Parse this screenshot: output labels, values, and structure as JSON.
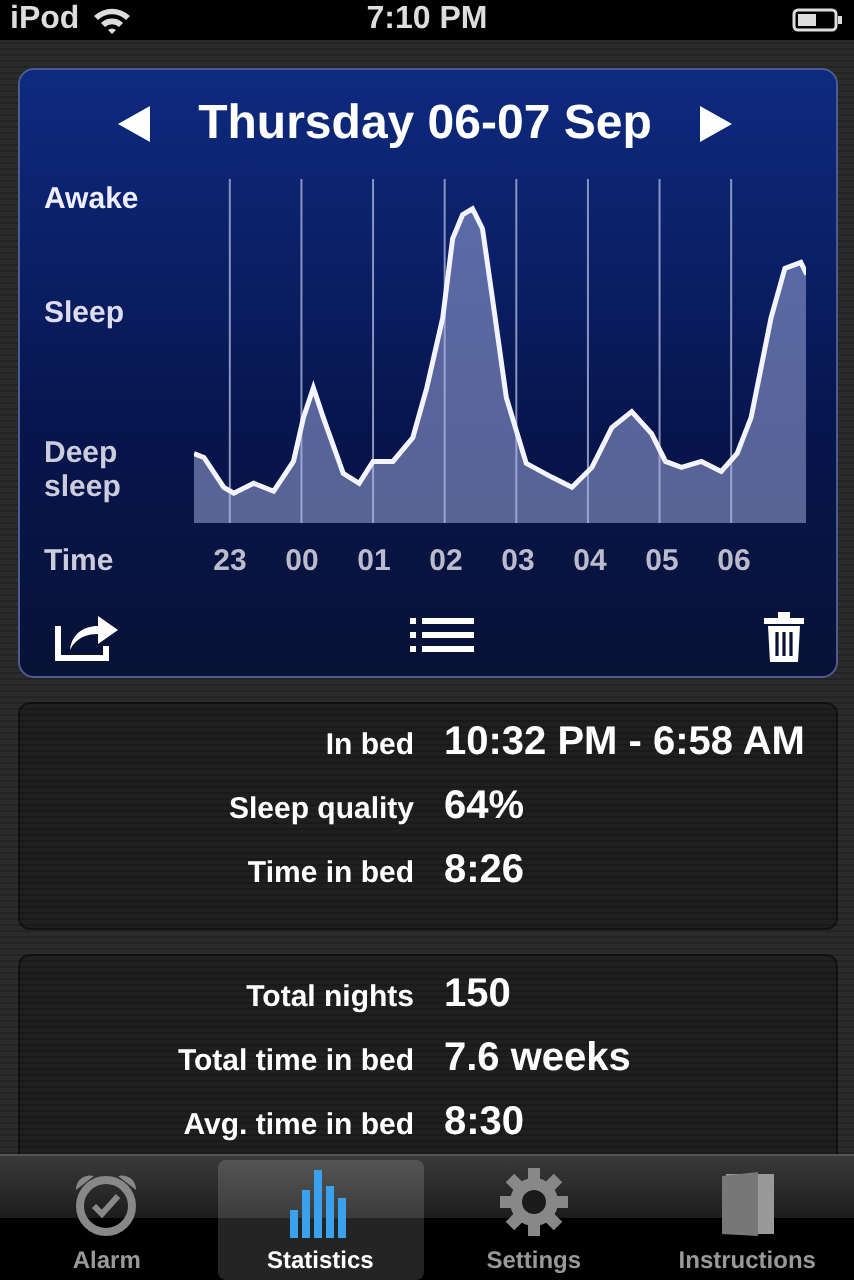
{
  "status_bar": {
    "carrier": "iPod",
    "time": "7:10 PM"
  },
  "night": {
    "title": "Thursday 06-07 Sep"
  },
  "graph": {
    "y_labels": [
      "Awake",
      "Sleep",
      "Deep sleep"
    ],
    "x_title": "Time",
    "x_labels": [
      "23",
      "00",
      "01",
      "02",
      "03",
      "04",
      "05",
      "06"
    ]
  },
  "night_stats": [
    {
      "label": "In bed",
      "value": "10:32 PM - 6:58 AM"
    },
    {
      "label": "Sleep quality",
      "value": "64%"
    },
    {
      "label": "Time in bed",
      "value": "8:26"
    }
  ],
  "totals": [
    {
      "label": "Total nights",
      "value": "150"
    },
    {
      "label": "Total time in bed",
      "value": "7.6 weeks"
    },
    {
      "label": "Avg. time in bed",
      "value": "8:30"
    }
  ],
  "tabs": [
    {
      "label": "Alarm",
      "kind": "alarm",
      "selected": false
    },
    {
      "label": "Statistics",
      "kind": "stats",
      "selected": true
    },
    {
      "label": "Settings",
      "kind": "gear",
      "selected": false
    },
    {
      "label": "Instructions",
      "kind": "book",
      "selected": false
    }
  ]
}
